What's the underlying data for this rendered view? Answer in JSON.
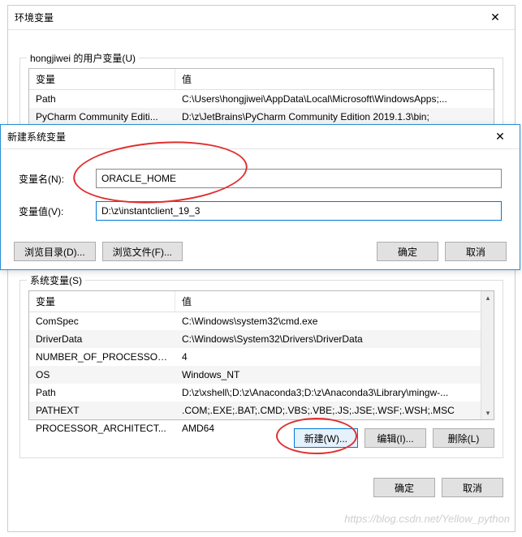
{
  "main_window": {
    "title": "环境变量",
    "user_vars_label": "hongjiwei 的用户变量(U)",
    "system_vars_label": "系统变量(S)",
    "col_var": "变量",
    "col_val": "值",
    "user_rows": [
      {
        "var": "Path",
        "val": "C:\\Users\\hongjiwei\\AppData\\Local\\Microsoft\\WindowsApps;..."
      },
      {
        "var": "PyCharm Community Editi...",
        "val": "D:\\z\\JetBrains\\PyCharm Community Edition 2019.1.3\\bin;"
      }
    ],
    "system_rows": [
      {
        "var": "ComSpec",
        "val": "C:\\Windows\\system32\\cmd.exe"
      },
      {
        "var": "DriverData",
        "val": "C:\\Windows\\System32\\Drivers\\DriverData"
      },
      {
        "var": "NUMBER_OF_PROCESSORS",
        "val": "4"
      },
      {
        "var": "OS",
        "val": "Windows_NT"
      },
      {
        "var": "Path",
        "val": "D:\\z\\xshell\\;D:\\z\\Anaconda3;D:\\z\\Anaconda3\\Library\\mingw-..."
      },
      {
        "var": "PATHEXT",
        "val": ".COM;.EXE;.BAT;.CMD;.VBS;.VBE;.JS;.JSE;.WSF;.WSH;.MSC"
      },
      {
        "var": "PROCESSOR_ARCHITECT...",
        "val": "AMD64"
      }
    ],
    "btn_new": "新建(W)...",
    "btn_edit": "编辑(I)...",
    "btn_delete": "删除(L)",
    "btn_ok": "确定",
    "btn_cancel": "取消"
  },
  "new_dialog": {
    "title": "新建系统变量",
    "name_label": "变量名(N):",
    "value_label": "变量值(V):",
    "name_value": "ORACLE_HOME",
    "value_value": "D:\\z\\instantclient_19_3",
    "btn_browse_dir": "浏览目录(D)...",
    "btn_browse_file": "浏览文件(F)...",
    "btn_ok": "确定",
    "btn_cancel": "取消"
  },
  "watermark": "https://blog.csdn.net/Yellow_python"
}
